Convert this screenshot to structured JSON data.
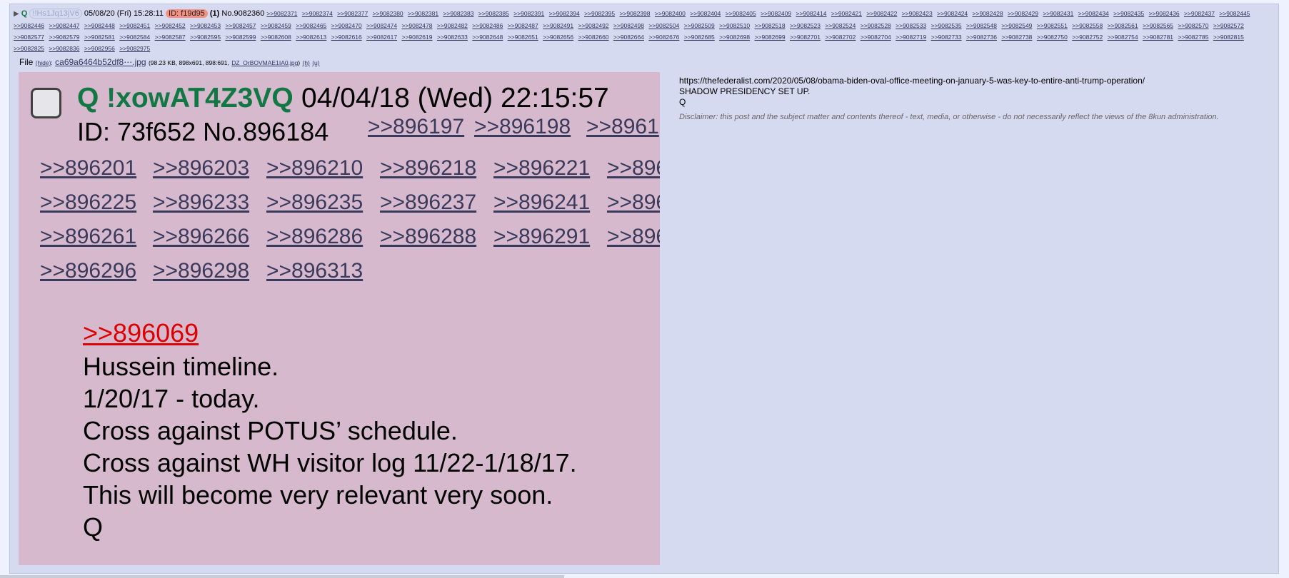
{
  "header": {
    "expand_icon": "▶",
    "name": "Q",
    "tripcode": "!!Hs1Jq13jV6",
    "datetime": "05/08/20 (Fri) 15:28:11",
    "id_label": "ID: f19d95",
    "post_count": "(1)",
    "post_no": "No.9082360",
    "replies": [
      ">>9082371",
      ">>9082374",
      ">>9082377",
      ">>9082380",
      ">>9082381",
      ">>9082383",
      ">>9082385",
      ">>9082391",
      ">>9082394",
      ">>9082395",
      ">>9082398",
      ">>9082400",
      ">>9082404",
      ">>9082405",
      ">>9082409",
      ">>9082414",
      ">>9082421",
      ">>9082422",
      ">>9082423",
      ">>9082424",
      ">>9082428",
      ">>9082429",
      ">>9082431",
      ">>9082434",
      ">>9082435",
      ">>9082436",
      ">>9082437",
      ">>9082445",
      ">>9082446",
      ">>9082447",
      ">>9082448",
      ">>9082451",
      ">>9082452",
      ">>9082453",
      ">>9082457",
      ">>9082459",
      ">>9082465",
      ">>9082470",
      ">>9082474",
      ">>9082478",
      ">>9082482",
      ">>9082486",
      ">>9082487",
      ">>9082491",
      ">>9082492",
      ">>9082498",
      ">>9082504",
      ">>9082509",
      ">>9082510",
      ">>9082518",
      ">>9082523",
      ">>9082524",
      ">>9082528",
      ">>9082533",
      ">>9082535",
      ">>9082548",
      ">>9082549",
      ">>9082551",
      ">>9082558",
      ">>9082561",
      ">>9082565",
      ">>9082570",
      ">>9082572",
      ">>9082577",
      ">>9082579",
      ">>9082581",
      ">>9082584",
      ">>9082587",
      ">>9082595",
      ">>9082599",
      ">>9082608",
      ">>9082613",
      ">>9082616",
      ">>9082617",
      ">>9082619",
      ">>9082633",
      ">>9082648",
      ">>9082651",
      ">>9082656",
      ">>9082660",
      ">>9082664",
      ">>9082676",
      ">>9082685",
      ">>9082698",
      ">>9082699",
      ">>9082701",
      ">>9082702",
      ">>9082704",
      ">>9082719",
      ">>9082733",
      ">>9082736",
      ">>9082738",
      ">>9082750",
      ">>9082752",
      ">>9082754",
      ">>9082781",
      ">>9082785",
      ">>9082815",
      ">>9082825",
      ">>9082836",
      ">>9082956",
      ">>9082975"
    ]
  },
  "file": {
    "label": "File",
    "hide": "(hide)",
    "filename": "ca69a6464b52df8⋯.jpg",
    "meta": "(98.23 KB, 898x691, 898:691,",
    "orig_name": "DZ_OrBOVMAE1IA0.jpg",
    "after": ")",
    "h_link": "(h)",
    "u_link": "(u)"
  },
  "image": {
    "name": "Q !xowAT4Z3VQ",
    "date": "04/04/18 (Wed) 22:15:57",
    "id_line": "ID: 73f652 No.896184",
    "reply_rows": [
      [
        ">>896197",
        ">>896198",
        ">>8961"
      ],
      [
        ">>896201",
        ">>896203",
        ">>896210",
        ">>896218",
        ">>896221",
        ">>896"
      ],
      [
        ">>896225",
        ">>896233",
        ">>896235",
        ">>896237",
        ">>896241",
        ">>896"
      ],
      [
        ">>896261",
        ">>896266",
        ">>896286",
        ">>896288",
        ">>896291",
        ">>896"
      ],
      [
        ">>896296",
        ">>896298",
        ">>896313"
      ]
    ],
    "quote_link": ">>896069",
    "body_lines": [
      "Hussein timeline.",
      "1/20/17 - today.",
      "Cross against POTUS’ schedule.",
      "Cross against WH visitor log 11/22-1/18/17.",
      "This will become very relevant very soon.",
      "Q"
    ]
  },
  "message": {
    "url": "https://thefederalist.com/2020/05/08/obama-biden-oval-office-meeting-on-january-5-was-key-to-entire-anti-trump-operation/",
    "line2": "SHADOW PRESIDENCY SET UP.",
    "line3": "Q",
    "disclaimer": "Disclaimer: this post and the subject matter and contents thereof - text, media, or otherwise - do not necessarily reflect the views of the 8kun administration."
  }
}
